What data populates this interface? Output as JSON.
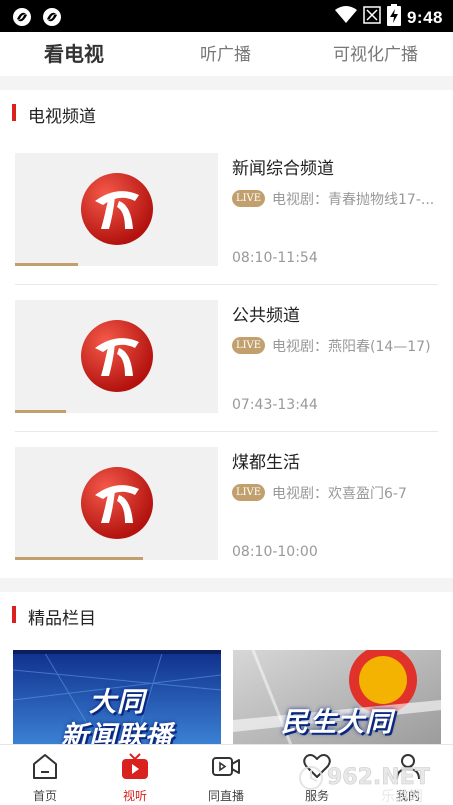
{
  "status_bar": {
    "time": "9:48"
  },
  "top_tabs": [
    {
      "label": "看电视",
      "active": true
    },
    {
      "label": "听广播",
      "active": false
    },
    {
      "label": "可视化广播",
      "active": false
    }
  ],
  "tv_section": {
    "title": "电视频道"
  },
  "channels": [
    {
      "name": "新闻综合频道",
      "live": "LIVE",
      "program": "电视剧：青春抛物线17-...",
      "time": "08:10-11:54",
      "progress": 0.31
    },
    {
      "name": "公共频道",
      "live": "LIVE",
      "program": "电视剧：燕阳春(14—17)",
      "time": "07:43-13:44",
      "progress": 0.25
    },
    {
      "name": "煤都生活",
      "live": "LIVE",
      "program": "电视剧：欢喜盈门6-7",
      "time": "08:10-10:00",
      "progress": 0.63
    }
  ],
  "featured_section": {
    "title": "精品栏目"
  },
  "featured": [
    {
      "line1": "大同",
      "line2": "新闻联播"
    },
    {
      "line1": "民生大同"
    }
  ],
  "bottom_nav": [
    {
      "label": "首页",
      "icon": "home-icon",
      "active": false
    },
    {
      "label": "视听",
      "icon": "tv-play-icon",
      "active": true
    },
    {
      "label": "同直播",
      "icon": "video-camera-icon",
      "active": false
    },
    {
      "label": "服务",
      "icon": "heart-icon",
      "active": false
    },
    {
      "label": "我的",
      "icon": "user-icon",
      "active": false
    }
  ],
  "watermark": {
    "text": "962.NET",
    "subtext": "乐游网"
  },
  "colors": {
    "accent_red": "#d9211d",
    "gold": "#c2a06d"
  }
}
